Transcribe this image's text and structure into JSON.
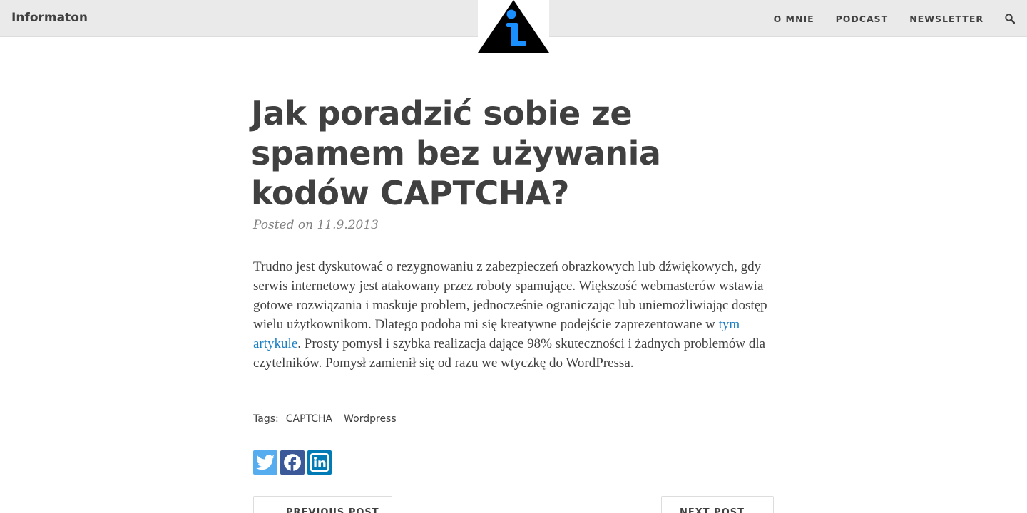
{
  "header": {
    "brand": "Informaton",
    "nav": [
      {
        "label": "O MNIE"
      },
      {
        "label": "PODCAST"
      },
      {
        "label": "NEWSLETTER"
      }
    ],
    "search_icon": "search-icon",
    "logo_icon": "info-triangle-logo"
  },
  "post": {
    "title": "Jak poradzić sobie ze spamem bez używania kodów CAPTCHA?",
    "meta": "Posted on 11.9.2013",
    "body_before_link": "Trudno jest dyskutować o rezygnowaniu z zabezpieczeń obrazkowych lub dźwiękowych, gdy serwis internetowy jest atakowany przez roboty spamujące. Większość webmasterów wstawia gotowe rozwiązania i maskuje problem, jednocześnie ograniczając lub uniemożliwiając dostęp wielu użytkownikom. Dlatego podoba mi się kreatywne podejście zaprezentowane w ",
    "link_text": "tym artykule",
    "body_after_link": ". Prosty pomysł i szybka realizacja dające 98% skuteczności i żadnych problemów dla czytelników. Pomysł zamienił się od razu we wtyczkę do WordPressa.",
    "tags_label": "Tags:",
    "tags": [
      "CAPTCHA",
      "Wordpress"
    ]
  },
  "share": {
    "twitter_icon": "twitter-icon",
    "facebook_icon": "facebook-icon",
    "linkedin_icon": "linkedin-icon"
  },
  "pager": {
    "previous": "PREVIOUS POST",
    "next": "NEXT POST"
  },
  "colors": {
    "navbar_bg": "#eaeaea",
    "text": "#404040",
    "meta": "#808080",
    "link": "#1a7fc4",
    "logo_blue": "#1a8fff",
    "twitter": "#55acee",
    "facebook": "#3b5998",
    "linkedin": "#007bb5"
  }
}
